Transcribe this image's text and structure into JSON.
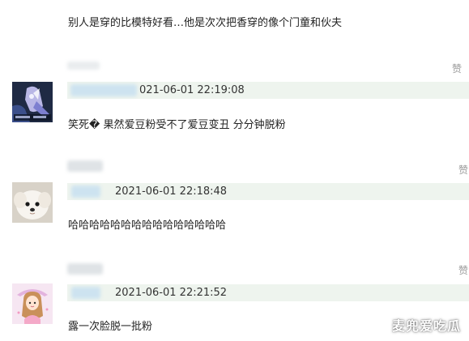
{
  "top_comment": {
    "text": "别人是穿的比模特好看…他是次次把香穿的像个门童和伙夫"
  },
  "comments": [
    {
      "time": "021-06-01 22:19:08",
      "text": "笑死� 果然爱豆粉受不了爱豆变丑 分分钟脱粉",
      "praise": "赞",
      "avatar_icon": "anime-character-avatar-icon"
    },
    {
      "time": "2021-06-01 22:18:48",
      "text": "哈哈哈哈哈哈哈哈哈哈哈哈哈哈哈",
      "praise": "赞",
      "avatar_icon": "white-dog-avatar-icon"
    },
    {
      "time": "2021-06-01 22:21:52",
      "text": "露一次脸脱一批粉",
      "praise": "赞",
      "avatar_icon": "cartoon-girl-avatar-icon"
    }
  ],
  "watermark": "麦兜爱吃瓜",
  "colors": {
    "meta_bar": "#eef4ee",
    "text": "#222222",
    "praise": "#9a9a9a"
  }
}
